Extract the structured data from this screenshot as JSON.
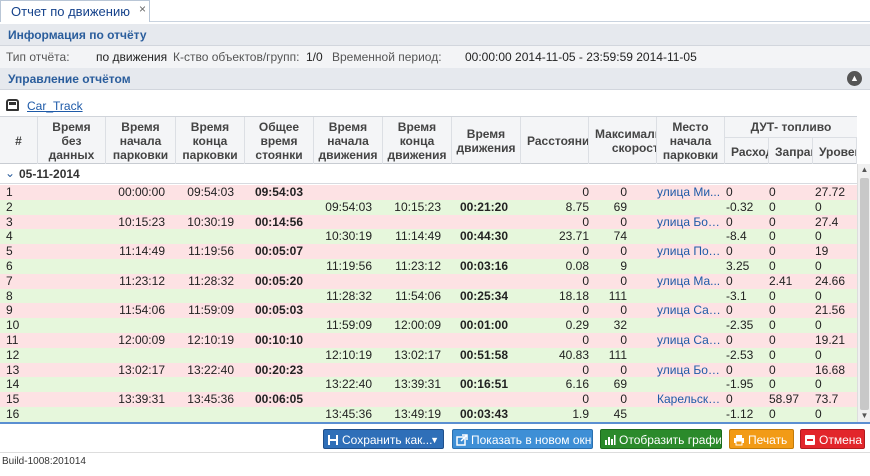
{
  "tab": {
    "title": "Отчет по движению",
    "close": "×"
  },
  "info_section": {
    "title": "Информация по отчёту"
  },
  "info": {
    "type_label": "Тип отчёта:",
    "type_value": "по движения",
    "count_label": "К-ство объектов/групп:",
    "count_value": "1/0",
    "period_label": "Временной период:",
    "period_value": "00:00:00 2014-11-05 - 23:59:59 2014-11-05"
  },
  "control_section": {
    "title": "Управление отчётом"
  },
  "object": {
    "name": "Car_Track"
  },
  "columns": {
    "num": "#",
    "no_data": "Время\nбез\nданных",
    "park_start": "Время\nначала\nпарковки",
    "park_end": "Время\nконца\nпарковки",
    "park_total": "Общее\nвремя\nстоянки",
    "move_start": "Время\nначала\nдвижения",
    "move_end": "Время\nконца\nдвижения",
    "move_time": "Время\nдвижения",
    "distance": "Расстояние",
    "max_speed": "Максимальная\nскорость",
    "park_place": "Место\nначала\nпарковки",
    "fuel_group": "ДУТ- топливо",
    "fuel_consumption": "Расход",
    "fuel_refill": "Заправка",
    "fuel_level": "Уровень"
  },
  "date_group": {
    "date": "05-11-2014"
  },
  "rows": [
    {
      "n": "1",
      "type": "park",
      "ps": "00:00:00",
      "pe": "09:54:03",
      "pt": "09:54:03",
      "ms": "",
      "me": "",
      "mt": "",
      "dist": "0",
      "spd": "0",
      "place": "улица Ми...",
      "cons": "0",
      "ref": "0",
      "lvl": "27.72"
    },
    {
      "n": "2",
      "type": "move",
      "ps": "",
      "pe": "",
      "pt": "",
      "ms": "09:54:03",
      "me": "10:15:23",
      "mt": "00:21:20",
      "dist": "8.75",
      "spd": "69",
      "place": "",
      "cons": "-0.32",
      "ref": "0",
      "lvl": "0"
    },
    {
      "n": "3",
      "type": "park",
      "ps": "10:15:23",
      "pe": "10:30:19",
      "pt": "00:14:56",
      "ms": "",
      "me": "",
      "mt": "",
      "dist": "0",
      "spd": "0",
      "place": "улица Бор...",
      "cons": "0",
      "ref": "0",
      "lvl": "27.4"
    },
    {
      "n": "4",
      "type": "move",
      "ps": "",
      "pe": "",
      "pt": "",
      "ms": "10:30:19",
      "me": "11:14:49",
      "mt": "00:44:30",
      "dist": "23.71",
      "spd": "74",
      "place": "",
      "cons": "-8.4",
      "ref": "0",
      "lvl": "0"
    },
    {
      "n": "5",
      "type": "park",
      "ps": "11:14:49",
      "pe": "11:19:56",
      "pt": "00:05:07",
      "ms": "",
      "me": "",
      "mt": "",
      "dist": "0",
      "spd": "0",
      "place": "улица Пол...",
      "cons": "0",
      "ref": "0",
      "lvl": "19"
    },
    {
      "n": "6",
      "type": "move",
      "ps": "",
      "pe": "",
      "pt": "",
      "ms": "11:19:56",
      "me": "11:23:12",
      "mt": "00:03:16",
      "dist": "0.08",
      "spd": "9",
      "place": "",
      "cons": "3.25",
      "ref": "0",
      "lvl": "0"
    },
    {
      "n": "7",
      "type": "park",
      "ps": "11:23:12",
      "pe": "11:28:32",
      "pt": "00:05:20",
      "ms": "",
      "me": "",
      "mt": "",
      "dist": "0",
      "spd": "0",
      "place": "улица Ма...",
      "cons": "0",
      "ref": "2.41",
      "lvl": "24.66"
    },
    {
      "n": "8",
      "type": "move",
      "ps": "",
      "pe": "",
      "pt": "",
      "ms": "11:28:32",
      "me": "11:54:06",
      "mt": "00:25:34",
      "dist": "18.18",
      "spd": "111",
      "place": "",
      "cons": "-3.1",
      "ref": "0",
      "lvl": "0"
    },
    {
      "n": "9",
      "type": "park",
      "ps": "11:54:06",
      "pe": "11:59:09",
      "pt": "00:05:03",
      "ms": "",
      "me": "",
      "mt": "",
      "dist": "0",
      "spd": "0",
      "place": "улица Сад...",
      "cons": "0",
      "ref": "0",
      "lvl": "21.56"
    },
    {
      "n": "10",
      "type": "move",
      "ps": "",
      "pe": "",
      "pt": "",
      "ms": "11:59:09",
      "me": "12:00:09",
      "mt": "00:01:00",
      "dist": "0.29",
      "spd": "32",
      "place": "",
      "cons": "-2.35",
      "ref": "0",
      "lvl": "0"
    },
    {
      "n": "11",
      "type": "park",
      "ps": "12:00:09",
      "pe": "12:10:19",
      "pt": "00:10:10",
      "ms": "",
      "me": "",
      "mt": "",
      "dist": "0",
      "spd": "0",
      "place": "улица Сад...",
      "cons": "0",
      "ref": "0",
      "lvl": "19.21"
    },
    {
      "n": "12",
      "type": "move",
      "ps": "",
      "pe": "",
      "pt": "",
      "ms": "12:10:19",
      "me": "13:02:17",
      "mt": "00:51:58",
      "dist": "40.83",
      "spd": "111",
      "place": "",
      "cons": "-2.53",
      "ref": "0",
      "lvl": "0"
    },
    {
      "n": "13",
      "type": "park",
      "ps": "13:02:17",
      "pe": "13:22:40",
      "pt": "00:20:23",
      "ms": "",
      "me": "",
      "mt": "",
      "dist": "0",
      "spd": "0",
      "place": "улица Бор...",
      "cons": "0",
      "ref": "0",
      "lvl": "16.68"
    },
    {
      "n": "14",
      "type": "move",
      "ps": "",
      "pe": "",
      "pt": "",
      "ms": "13:22:40",
      "me": "13:39:31",
      "mt": "00:16:51",
      "dist": "6.16",
      "spd": "69",
      "place": "",
      "cons": "-1.95",
      "ref": "0",
      "lvl": "0"
    },
    {
      "n": "15",
      "type": "park",
      "ps": "13:39:31",
      "pe": "13:45:36",
      "pt": "00:06:05",
      "ms": "",
      "me": "",
      "mt": "",
      "dist": "0",
      "spd": "0",
      "place": "Карельски...",
      "cons": "0",
      "ref": "58.97",
      "lvl": "73.7"
    },
    {
      "n": "16",
      "type": "move",
      "ps": "",
      "pe": "",
      "pt": "",
      "ms": "13:45:36",
      "me": "13:49:19",
      "mt": "00:03:43",
      "dist": "1.9",
      "spd": "45",
      "place": "",
      "cons": "-1.12",
      "ref": "0",
      "lvl": "0"
    }
  ],
  "buttons": {
    "save": "Сохранить как...",
    "new_window": "Показать в новом окне",
    "chart": "Отобразить график",
    "print": "Печать",
    "cancel": "Отмена"
  },
  "status": {
    "build": "Build-1008:201014"
  }
}
